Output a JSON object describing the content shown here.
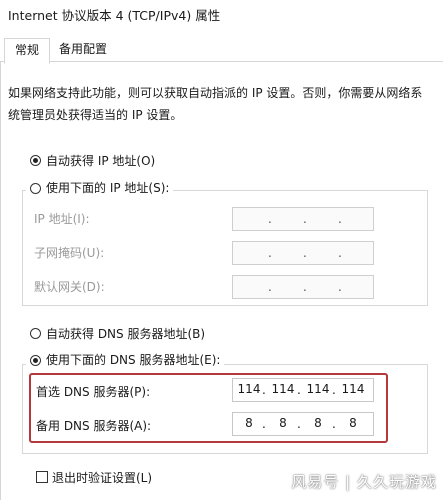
{
  "window": {
    "title": "Internet 协议版本 4 (TCP/IPv4) 属性"
  },
  "tabs": [
    {
      "label": "常规",
      "selected": true
    },
    {
      "label": "备用配置",
      "selected": false
    }
  ],
  "description": "如果网络支持此功能，则可以获取自动指派的 IP 设置。否则，你需要从网络系统管理员处获得适当的 IP 设置。",
  "ip_mode": {
    "auto_label": "自动获得 IP 地址(O)",
    "auto_selected": true,
    "manual_label": "使用下面的 IP 地址(S):",
    "manual_selected": false
  },
  "ip_fields": [
    {
      "label": "IP 地址(I):",
      "value": [
        "",
        "",
        "",
        ""
      ]
    },
    {
      "label": "子网掩码(U):",
      "value": [
        "",
        "",
        "",
        ""
      ]
    },
    {
      "label": "默认网关(D):",
      "value": [
        "",
        "",
        "",
        ""
      ]
    }
  ],
  "dns_mode": {
    "auto_label": "自动获得 DNS 服务器地址(B)",
    "auto_selected": false,
    "manual_label": "使用下面的 DNS 服务器地址(E):",
    "manual_selected": true
  },
  "dns_fields": [
    {
      "label": "首选 DNS 服务器(P):",
      "value": [
        "114",
        "114",
        "114",
        "114"
      ]
    },
    {
      "label": "备用 DNS 服务器(A):",
      "value": [
        "8",
        "8",
        "8",
        "8"
      ]
    }
  ],
  "validate_on_exit": {
    "label": "退出时验证设置(L)",
    "checked": false
  },
  "watermark": "风易号 | 久久玩游戏",
  "colors": {
    "highlight": "#b5383b",
    "disabled_text": "#9a9a9a"
  },
  "icons": {
    "radio_checked": "radio-checked-icon",
    "radio_unchecked": "radio-unchecked-icon",
    "checkbox": "checkbox-icon"
  }
}
